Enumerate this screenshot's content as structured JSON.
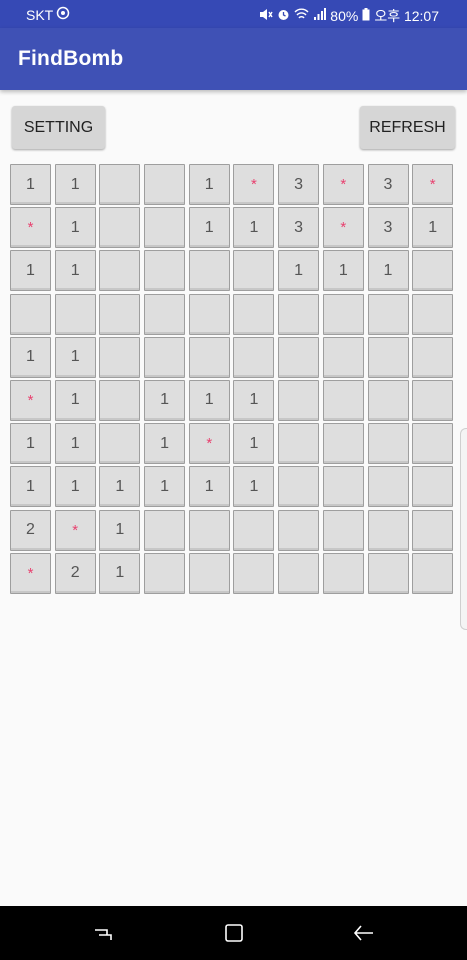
{
  "status_bar": {
    "carrier": "SKT",
    "battery": "80%",
    "time": "오후 12:07",
    "icons": [
      "vpn-icon",
      "mute-icon",
      "alarm-icon",
      "wifi-icon",
      "signal-icon",
      "battery-icon"
    ]
  },
  "app": {
    "title": "FindBomb",
    "theme_color": "#3f51b5"
  },
  "toolbar": {
    "setting_label": "SETTING",
    "refresh_label": "REFRESH"
  },
  "board": {
    "bomb_symbol": "*",
    "bomb_color": "#e8416f",
    "rows": [
      [
        "1",
        "1",
        "",
        "",
        "1",
        "*",
        "3",
        "*",
        "3",
        "*"
      ],
      [
        "*",
        "1",
        "",
        "",
        "1",
        "1",
        "3",
        "*",
        "3",
        "1"
      ],
      [
        "1",
        "1",
        "",
        "",
        "",
        "",
        "1",
        "1",
        "1",
        ""
      ],
      [
        "",
        "",
        "",
        "",
        "",
        "",
        "",
        "",
        "",
        ""
      ],
      [
        "1",
        "1",
        "",
        "",
        "",
        "",
        "",
        "",
        "",
        ""
      ],
      [
        "*",
        "1",
        "",
        "1",
        "1",
        "1",
        "",
        "",
        "",
        ""
      ],
      [
        "1",
        "1",
        "",
        "1",
        "*",
        "1",
        "",
        "",
        "",
        ""
      ],
      [
        "1",
        "1",
        "1",
        "1",
        "1",
        "1",
        "",
        "",
        "",
        ""
      ],
      [
        "2",
        "*",
        "1",
        "",
        "",
        "",
        "",
        "",
        "",
        ""
      ],
      [
        "*",
        "2",
        "1",
        "",
        "",
        "",
        "",
        "",
        "",
        ""
      ]
    ]
  },
  "nav_bar": {
    "icons": [
      "recent-apps-icon",
      "home-icon",
      "back-icon"
    ]
  }
}
